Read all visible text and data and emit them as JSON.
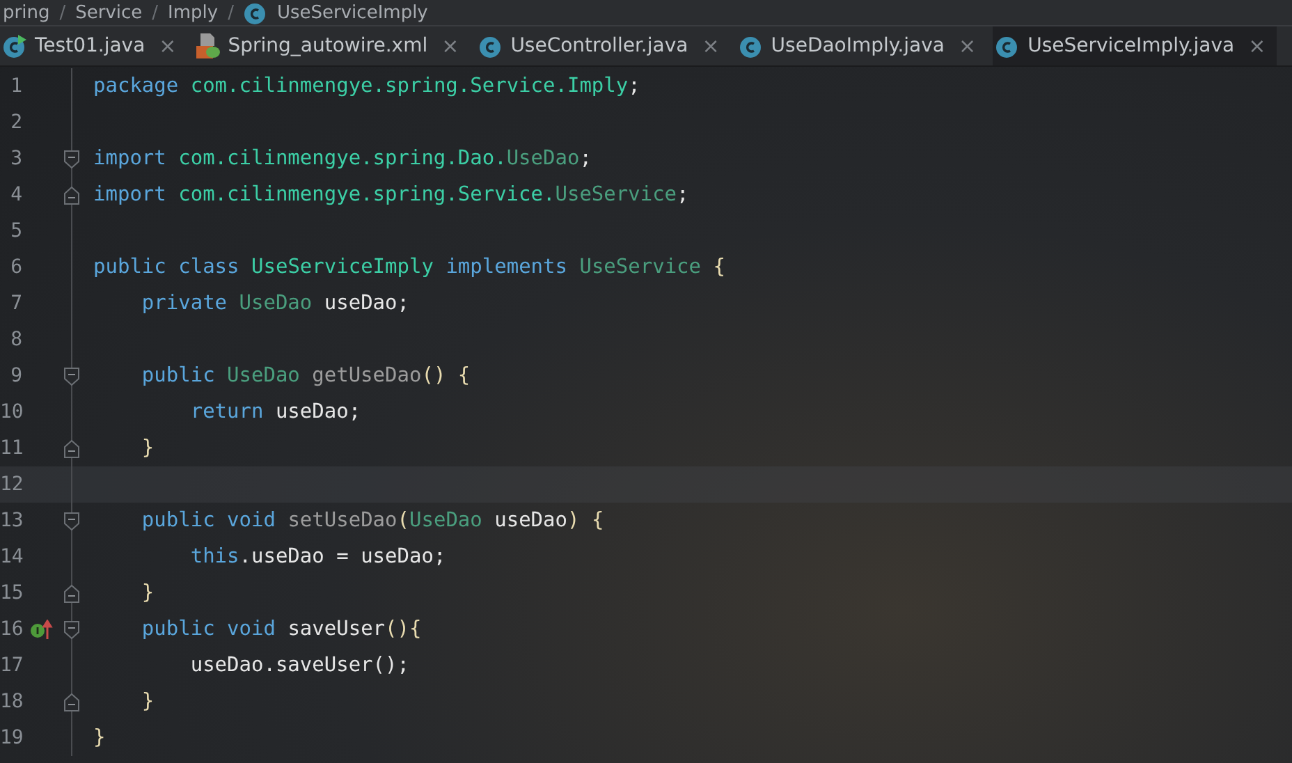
{
  "breadcrumb": [
    {
      "label": "pring",
      "icon": false
    },
    {
      "separator": "/",
      "label": "Service",
      "icon": false
    },
    {
      "separator": "/",
      "label": "Imply",
      "icon": false
    },
    {
      "separator": "/",
      "label": "UseServiceImply",
      "icon": true
    }
  ],
  "tabs": [
    {
      "label": "Test01.java",
      "kind": "runnable-class",
      "selected": false,
      "close": "×"
    },
    {
      "label": "Spring_autowire.xml",
      "kind": "spring-xml",
      "selected": false,
      "close": "×"
    },
    {
      "label": "UseController.java",
      "kind": "class",
      "selected": false,
      "close": "×"
    },
    {
      "label": "UseDaoImply.java",
      "kind": "class",
      "selected": false,
      "close": "×"
    },
    {
      "label": "UseServiceImply.java",
      "kind": "class",
      "selected": true,
      "close": "×"
    }
  ],
  "lines": [
    {
      "number": "1",
      "fold_start": false,
      "fold_end": false,
      "marker": false,
      "current": false,
      "tokens": [
        {
          "t": "package ",
          "kind": "keyword"
        },
        {
          "t": "com.cilinmengye.spring.Service.Imply",
          "kind": "package"
        },
        {
          "t": ";",
          "kind": "plain"
        }
      ]
    },
    {
      "number": "2",
      "fold_start": false,
      "fold_end": false,
      "marker": false,
      "current": false
    },
    {
      "number": "3",
      "fold_start": true,
      "fold_end": false,
      "marker": false,
      "current": false,
      "tokens": [
        {
          "t": "import ",
          "kind": "keyword"
        },
        {
          "t": "com.cilinmengye.spring.Dao.",
          "kind": "package"
        },
        {
          "t": "UseDao",
          "kind": "type"
        },
        {
          "t": ";",
          "kind": "plain"
        }
      ]
    },
    {
      "number": "4",
      "fold_start": false,
      "fold_end": true,
      "marker": false,
      "current": false,
      "tokens": [
        {
          "t": "import ",
          "kind": "keyword"
        },
        {
          "t": "com.cilinmengye.spring.Service.",
          "kind": "package"
        },
        {
          "t": "UseService",
          "kind": "type"
        },
        {
          "t": ";",
          "kind": "plain"
        }
      ]
    },
    {
      "number": "5",
      "fold_start": false,
      "fold_end": false,
      "marker": false,
      "current": false
    },
    {
      "number": "6",
      "fold_start": false,
      "fold_end": false,
      "marker": false,
      "current": false,
      "tokens": [
        {
          "t": "public class ",
          "kind": "keyword"
        },
        {
          "t": "UseServiceImply ",
          "kind": "package"
        },
        {
          "t": "implements ",
          "kind": "keyword"
        },
        {
          "t": "UseService ",
          "kind": "type"
        },
        {
          "t": "{",
          "kind": "brace"
        }
      ]
    },
    {
      "number": "7",
      "fold_start": false,
      "fold_end": false,
      "marker": false,
      "current": false,
      "tokens": [
        {
          "t": "    private ",
          "kind": "keyword"
        },
        {
          "t": "UseDao ",
          "kind": "type"
        },
        {
          "t": "useDao;",
          "kind": "plain"
        }
      ]
    },
    {
      "number": "8",
      "fold_start": false,
      "fold_end": false,
      "marker": false,
      "current": false
    },
    {
      "number": "9",
      "fold_start": true,
      "fold_end": false,
      "marker": false,
      "current": false,
      "tokens": [
        {
          "t": "    public ",
          "kind": "keyword"
        },
        {
          "t": "UseDao ",
          "kind": "type"
        },
        {
          "t": "getUseDao",
          "kind": "method"
        },
        {
          "t": "() {",
          "kind": "brace"
        }
      ]
    },
    {
      "number": "10",
      "fold_start": false,
      "fold_end": false,
      "marker": false,
      "current": false,
      "tokens": [
        {
          "t": "        return ",
          "kind": "keyword"
        },
        {
          "t": "useDao;",
          "kind": "plain"
        }
      ]
    },
    {
      "number": "11",
      "fold_start": false,
      "fold_end": true,
      "marker": false,
      "current": false,
      "tokens": [
        {
          "t": "    }",
          "kind": "brace"
        }
      ]
    },
    {
      "number": "12",
      "fold_start": false,
      "fold_end": false,
      "marker": false,
      "current": true
    },
    {
      "number": "13",
      "fold_start": true,
      "fold_end": false,
      "marker": false,
      "current": false,
      "tokens": [
        {
          "t": "    public void ",
          "kind": "keyword"
        },
        {
          "t": "setUseDao",
          "kind": "method"
        },
        {
          "t": "(",
          "kind": "brace"
        },
        {
          "t": "UseDao ",
          "kind": "type"
        },
        {
          "t": "useDao",
          "kind": "plain"
        },
        {
          "t": ") {",
          "kind": "brace"
        }
      ]
    },
    {
      "number": "14",
      "fold_start": false,
      "fold_end": false,
      "marker": false,
      "current": false,
      "tokens": [
        {
          "t": "        this",
          "kind": "keyword"
        },
        {
          "t": ".useDao = useDao;",
          "kind": "plain"
        }
      ]
    },
    {
      "number": "15",
      "fold_start": false,
      "fold_end": true,
      "marker": false,
      "current": false,
      "tokens": [
        {
          "t": "    }",
          "kind": "brace"
        }
      ]
    },
    {
      "number": "16",
      "fold_start": true,
      "fold_end": false,
      "marker": true,
      "current": false,
      "tokens": [
        {
          "t": "    public void ",
          "kind": "keyword"
        },
        {
          "t": "saveUser",
          "kind": "plain"
        },
        {
          "t": "(){",
          "kind": "brace"
        }
      ]
    },
    {
      "number": "17",
      "fold_start": false,
      "fold_end": false,
      "marker": false,
      "current": false,
      "tokens": [
        {
          "t": "        useDao.saveUser();",
          "kind": "plain"
        }
      ]
    },
    {
      "number": "18",
      "fold_start": false,
      "fold_end": true,
      "marker": false,
      "current": false,
      "tokens": [
        {
          "t": "    }",
          "kind": "brace"
        }
      ]
    },
    {
      "number": "19",
      "fold_start": false,
      "fold_end": false,
      "marker": false,
      "current": false,
      "tokens": [
        {
          "t": "}",
          "kind": "brace"
        }
      ]
    }
  ]
}
